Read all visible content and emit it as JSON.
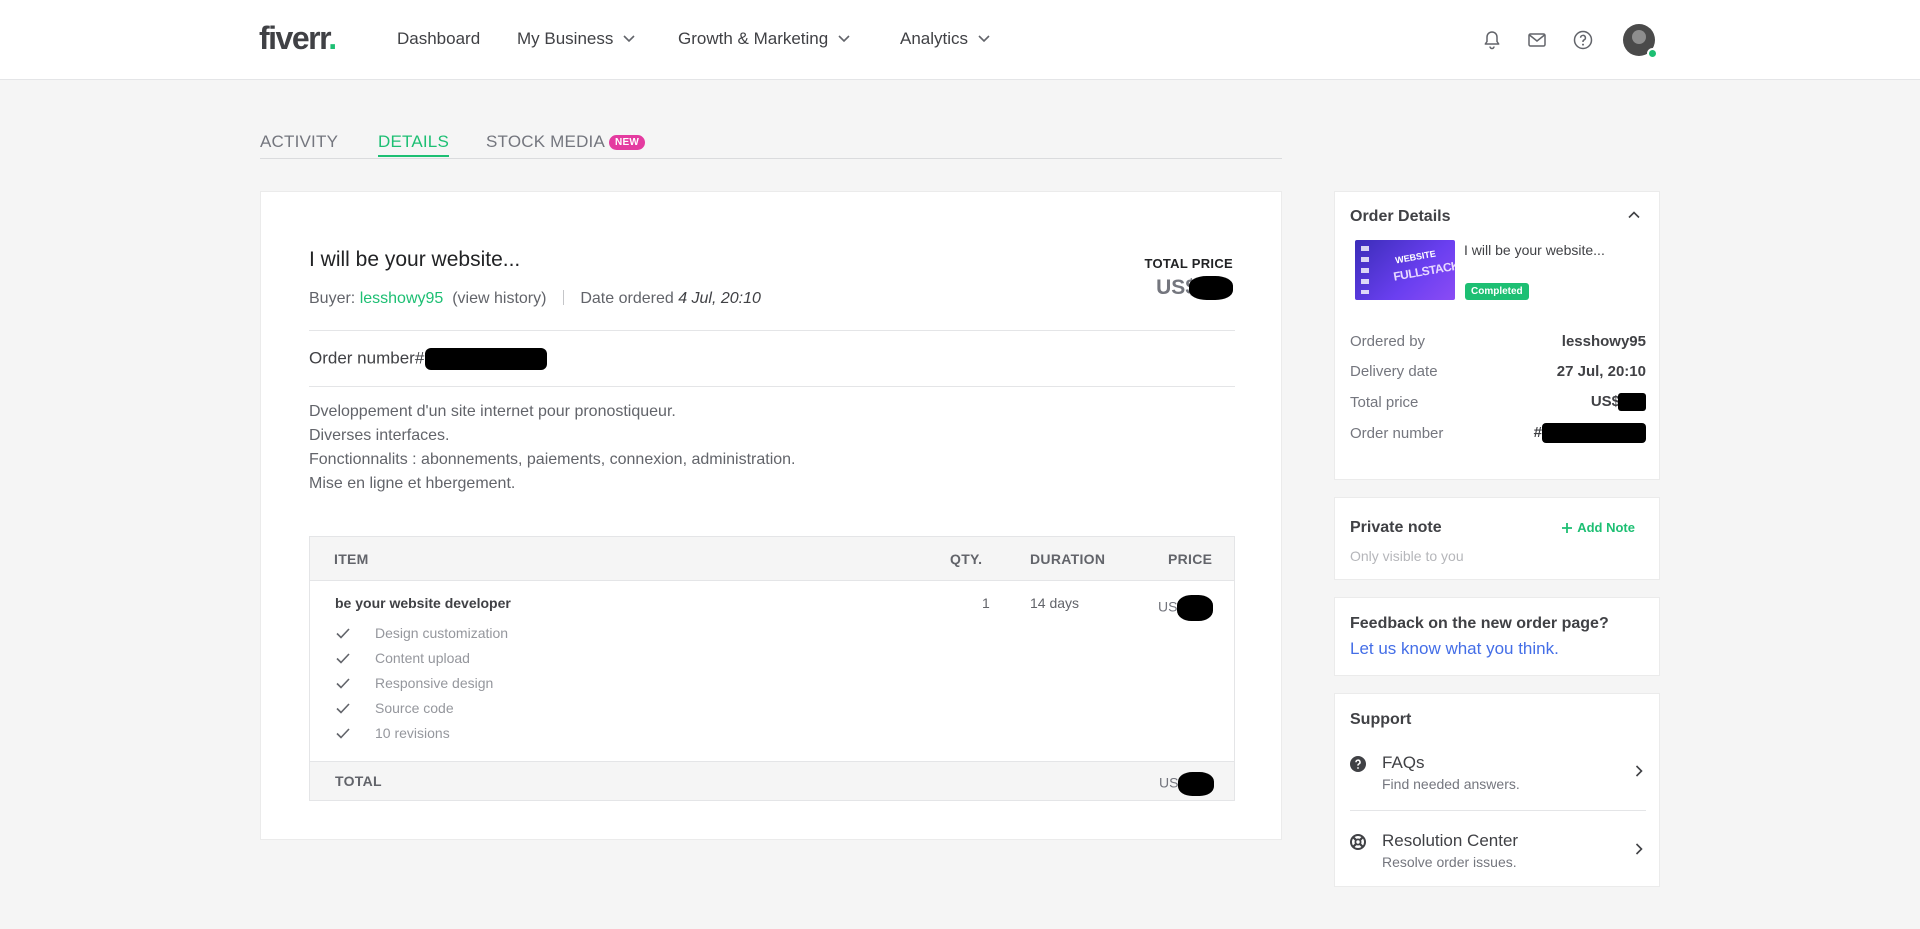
{
  "header": {
    "logo": "fiverr",
    "logo_dot": ".",
    "nav": [
      {
        "label": "Dashboard"
      },
      {
        "label": "My Business"
      },
      {
        "label": "Growth & Marketing"
      },
      {
        "label": "Analytics"
      }
    ]
  },
  "tabs": {
    "activity": "ACTIVITY",
    "details": "DETAILS",
    "stock_media": "STOCK MEDIA",
    "new_badge": "NEW"
  },
  "order": {
    "title": "I will be your website...",
    "buyer_label": "Buyer:",
    "buyer": "lesshowy95",
    "view_history": "(view history)",
    "date_label": "Date ordered",
    "date": "4 Jul, 20:10",
    "total_price_label": "TOTAL PRICE",
    "currency": "US$",
    "order_number_label": "Order number#",
    "description": [
      "Dveloppement d'un site internet pour pronostiqueur.",
      "Diverses interfaces.",
      "Fonctionnalits : abonnements, paiements, connexion, administration.",
      "Mise en ligne et hbergement."
    ]
  },
  "table": {
    "headers": {
      "item": "ITEM",
      "qty": "QTY.",
      "duration": "DURATION",
      "price": "PRICE"
    },
    "item_name": "be your website developer",
    "qty": "1",
    "duration": "14 days",
    "price_currency": "US$",
    "features": [
      "Design customization",
      "Content upload",
      "Responsive design",
      "Source code",
      "10 revisions"
    ],
    "total_label": "TOTAL",
    "total_currency": "US$"
  },
  "sidebar": {
    "order_details": {
      "title": "Order Details",
      "gig_title": "I will be your website...",
      "thumb_line1": "WEBSITE",
      "thumb_line2": "FULLSTACK",
      "status": "Completed",
      "ordered_by_label": "Ordered by",
      "ordered_by": "lesshowy95",
      "delivery_label": "Delivery date",
      "delivery": "27 Jul, 20:10",
      "total_label": "Total price",
      "total_currency": "US$",
      "order_number_label": "Order number",
      "order_number_prefix": "#"
    },
    "private_note": {
      "title": "Private note",
      "add": "Add Note",
      "sub": "Only visible to you"
    },
    "feedback": {
      "title": "Feedback on the new order page?",
      "link": "Let us know what you think."
    },
    "support": {
      "title": "Support",
      "faqs": "FAQs",
      "faqs_sub": "Find needed answers.",
      "resolution": "Resolution Center",
      "resolution_sub": "Resolve order issues."
    }
  },
  "colors": {
    "brand_green": "#1dbf73",
    "new_badge": "#e43ba0",
    "link_blue": "#446ee7"
  }
}
